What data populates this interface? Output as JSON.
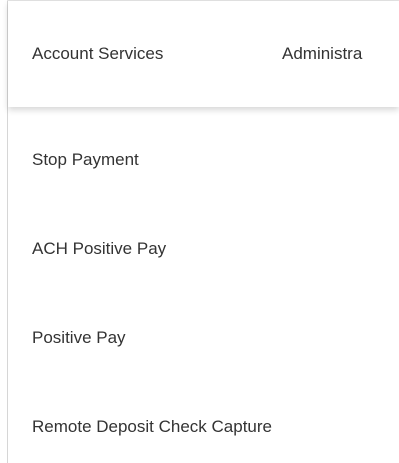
{
  "nav": {
    "tabs": [
      {
        "label": "Account Services"
      },
      {
        "label": "Administra"
      }
    ]
  },
  "menu": {
    "items": [
      {
        "label": "Stop Payment"
      },
      {
        "label": "ACH Positive Pay"
      },
      {
        "label": "Positive Pay"
      },
      {
        "label": "Remote Deposit Check Capture"
      }
    ]
  },
  "colors": {
    "text": "#333333",
    "background": "#ffffff",
    "border": "#d6d6d6"
  }
}
